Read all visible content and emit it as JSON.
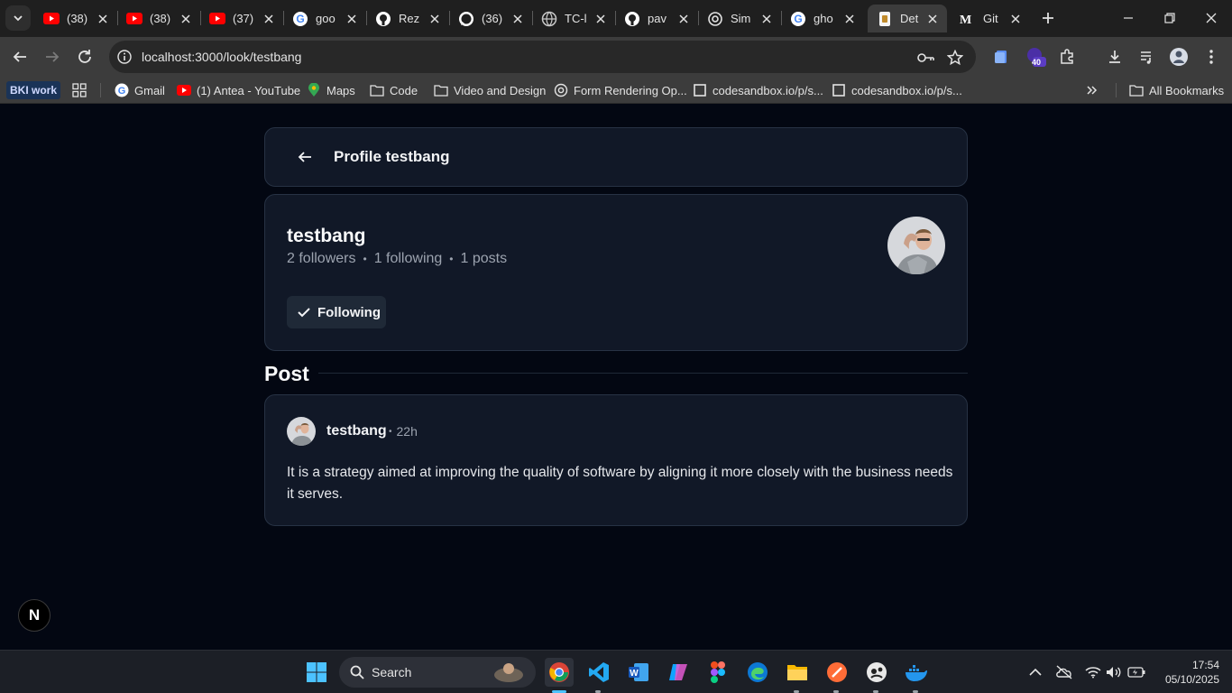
{
  "browser": {
    "tabs": [
      {
        "title": "(38)",
        "icon": "youtube-icon"
      },
      {
        "title": "(38)",
        "icon": "youtube-icon"
      },
      {
        "title": "(37)",
        "icon": "youtube-icon"
      },
      {
        "title": "goo",
        "icon": "google-icon"
      },
      {
        "title": "Rez",
        "icon": "github-icon"
      },
      {
        "title": "(36)",
        "icon": "whatsapp-icon"
      },
      {
        "title": "TC-l",
        "icon": "globe-icon"
      },
      {
        "title": "pav",
        "icon": "github-icon"
      },
      {
        "title": "Sim",
        "icon": "openai-icon"
      },
      {
        "title": "gho",
        "icon": "google-icon"
      },
      {
        "title": "Det",
        "icon": "page-icon"
      },
      {
        "title": "Git",
        "icon": "medium-icon"
      }
    ],
    "active_tab_index": 10,
    "url": "localhost:3000/look/testbang",
    "extension_badge": "40",
    "bookmarks": {
      "work_label": "BKI work",
      "items": [
        {
          "label": "Gmail",
          "icon": "google-icon"
        },
        {
          "label": "(1) Antea - YouTube",
          "icon": "youtube-icon"
        },
        {
          "label": "Maps",
          "icon": "maps-icon"
        },
        {
          "label": "Code",
          "icon": "folder-icon"
        },
        {
          "label": "Video and Design",
          "icon": "folder-icon"
        },
        {
          "label": "Form Rendering Op...",
          "icon": "openai-icon"
        },
        {
          "label": "codesandbox.io/p/s...",
          "icon": "codesandbox-icon"
        },
        {
          "label": "codesandbox.io/p/s...",
          "icon": "codesandbox-icon"
        }
      ],
      "all_bookmarks": "All Bookmarks"
    }
  },
  "page": {
    "header_title": "Profile testbang",
    "profile": {
      "username": "testbang",
      "followers": "2 followers",
      "following": "1 following",
      "posts": "1 posts",
      "follow_button": "Following"
    },
    "section_title": "Post",
    "post": {
      "author": "testbang",
      "time": "22h",
      "body": "It is a strategy aimed at improving the quality of software by aligning it more closely with the business needs it serves."
    },
    "dev_badge": "N"
  },
  "taskbar": {
    "search_label": "Search",
    "time": "17:54",
    "date": "05/10/2025"
  },
  "colors": {
    "page_bg": "#030712",
    "card_bg": "#111827",
    "card_border": "#273244",
    "muted_text": "#9ca3af"
  }
}
